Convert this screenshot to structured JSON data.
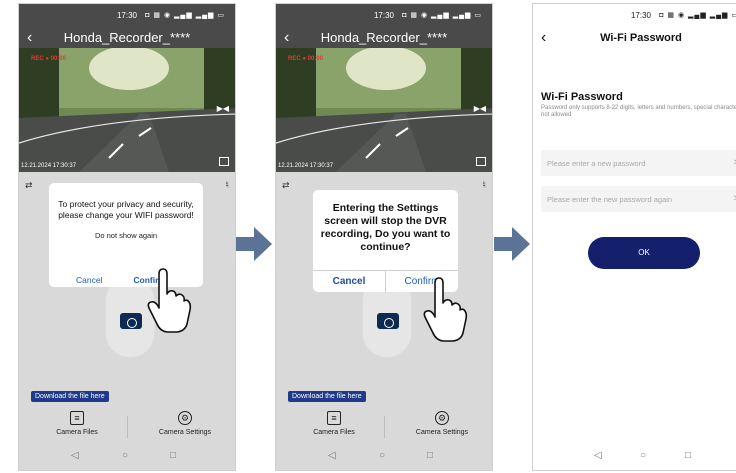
{
  "colors": {
    "accent_blue": "#1e5fb8",
    "navy_button": "#14206b",
    "tooltip_blue": "#1f3a8a",
    "arrow": "#5a7396"
  },
  "status": {
    "time": "17:30",
    "icons": "◘ ▦ ◉ ▂▄▆ ▂▄▆ ▭"
  },
  "recorder": {
    "title": "Honda_Recorder_****",
    "timestamp": "12.21.2024 17:30:37",
    "rec_overlay": "REC ● 00:00",
    "download_tip": "Download the file here",
    "tabs": {
      "files": "Camera Files",
      "settings": "Camera Settings"
    }
  },
  "dialog1": {
    "message": "To protect your privacy and security, please change your WIFI password!",
    "do_not_show": "Do not show again",
    "cancel": "Cancel",
    "confirm": "Confirm"
  },
  "dialog2": {
    "message": "Entering the Settings screen will stop the DVR recording, Do you want to continue?",
    "cancel": "Cancel",
    "confirm": "Confirm"
  },
  "wifi": {
    "title": "Wi-Fi Password",
    "heading": "Wi-Fi Password",
    "hint": "Password only supports 8-22 digits, letters and numbers, special characters not allowed",
    "field1_placeholder": "Please enter a new password",
    "field2_placeholder": "Please enter the new password again",
    "ok": "OK"
  },
  "icons": {
    "back": "‹",
    "nav_back": "◁",
    "nav_home": "○",
    "nav_recent": "□",
    "eye": "≻‿"
  }
}
